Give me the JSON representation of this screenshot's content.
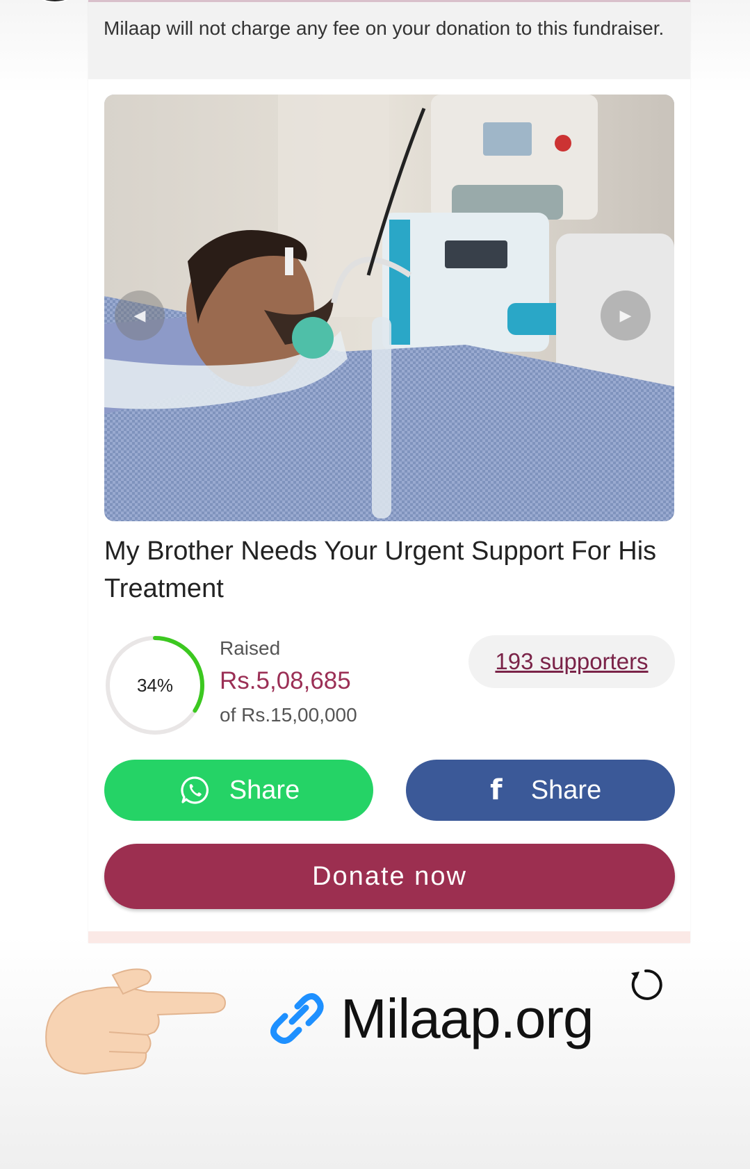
{
  "banner": {
    "fee_text": "Milaap will not charge any fee on your donation to this fundraiser."
  },
  "fundraiser": {
    "title": "My Brother Needs Your Urgent Support For His Treatment",
    "progress_percent_label": "34%",
    "progress_fraction": 0.34,
    "raised_label": "Raised",
    "raised_amount": "Rs.5,08,685",
    "goal_text": "of Rs.15,00,000",
    "supporters_label": "193 supporters"
  },
  "actions": {
    "whatsapp_share_label": "Share",
    "facebook_share_label": "Share",
    "donate_label": "Donate now"
  },
  "story_overlay": {
    "link_label": "Milaap.org"
  },
  "colors": {
    "accent": "#9c2f50",
    "raised_amount": "#9b2f55",
    "whatsapp_green": "#25d366",
    "facebook_blue": "#3b5998",
    "progress_green": "#3cc820"
  },
  "icons": [
    "whatsapp-icon",
    "facebook-icon",
    "link-icon",
    "pointing-hand-emoji",
    "refresh-icon",
    "chevron-left-icon",
    "chevron-right-icon"
  ]
}
